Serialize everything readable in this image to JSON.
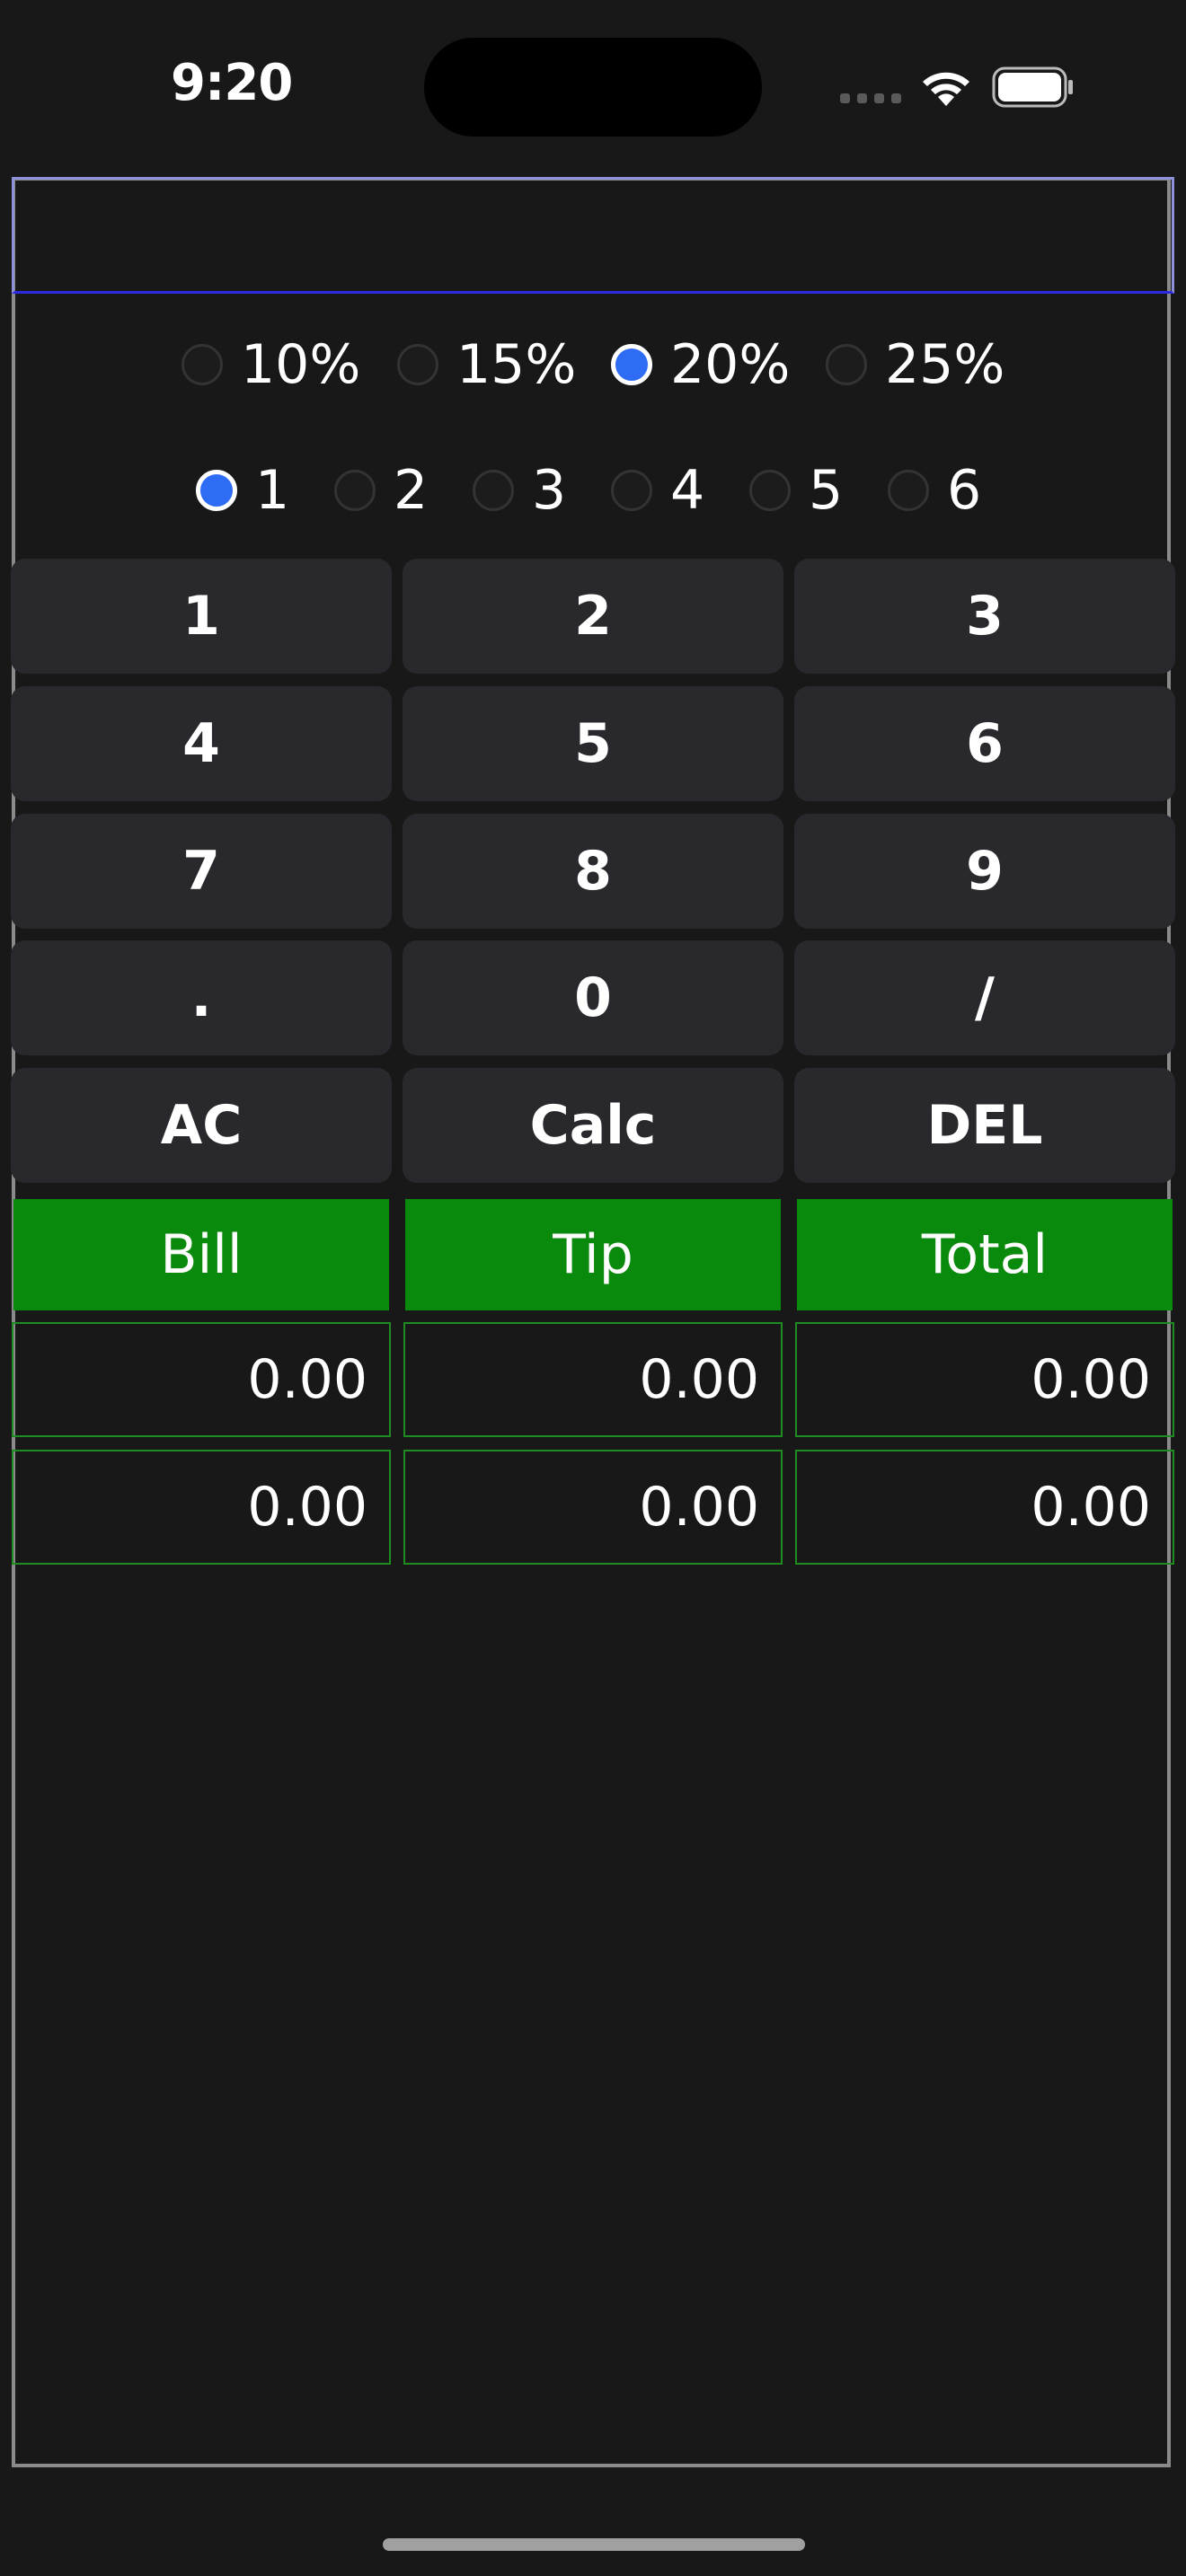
{
  "status_bar": {
    "time": "9:20"
  },
  "tip_options": [
    {
      "label": "10%",
      "checked": false
    },
    {
      "label": "15%",
      "checked": false
    },
    {
      "label": "20%",
      "checked": true
    },
    {
      "label": "25%",
      "checked": false
    }
  ],
  "split_options": [
    {
      "label": "1",
      "checked": true
    },
    {
      "label": "2",
      "checked": false
    },
    {
      "label": "3",
      "checked": false
    },
    {
      "label": "4",
      "checked": false
    },
    {
      "label": "5",
      "checked": false
    },
    {
      "label": "6",
      "checked": false
    }
  ],
  "keys": [
    [
      "1",
      "2",
      "3"
    ],
    [
      "4",
      "5",
      "6"
    ],
    [
      "7",
      "8",
      "9"
    ],
    [
      ".",
      "0",
      "/"
    ],
    [
      "AC",
      "Calc",
      "DEL"
    ]
  ],
  "results": {
    "headers": [
      "Bill",
      "Tip",
      "Total"
    ],
    "rows": [
      [
        "0.00",
        "0.00",
        "0.00"
      ],
      [
        "0.00",
        "0.00",
        "0.00"
      ]
    ]
  },
  "colors": {
    "accent_radio": "#2f6cf6",
    "header_green": "#0a8a0d",
    "cell_border": "#1f8c22",
    "background": "#181818",
    "key_background": "#29292d"
  }
}
